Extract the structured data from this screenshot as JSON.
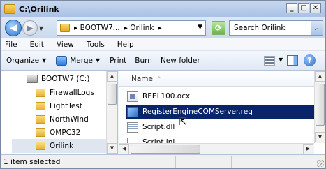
{
  "window": {
    "title": "C:\\Orilink"
  },
  "caption_buttons": {
    "minimize": "_",
    "maximize": "□",
    "close": "✕"
  },
  "address": {
    "segments": [
      "▸ BOOTW7...",
      "▸ Orilink",
      "▸"
    ],
    "search_placeholder": "Search Orilink"
  },
  "menu": {
    "items": [
      "File",
      "Edit",
      "View",
      "Tools",
      "Help"
    ]
  },
  "commands": {
    "organize": "Organize",
    "merge": "Merge",
    "print": "Print",
    "burn": "Burn",
    "new_folder": "New folder"
  },
  "nav_tree": {
    "items": [
      {
        "label": "BOOTW7 (C:)",
        "icon": "drive-icon"
      },
      {
        "label": "FirewallLogs",
        "icon": "folder-icon"
      },
      {
        "label": "LightTest",
        "icon": "folder-icon"
      },
      {
        "label": "NorthWind",
        "icon": "folder-icon"
      },
      {
        "label": "OMPC32",
        "icon": "folder-icon"
      },
      {
        "label": "Orilink",
        "icon": "folder-icon",
        "selected": true
      }
    ]
  },
  "file_list": {
    "column_name": "Name",
    "sort_glyph": "^",
    "files": [
      {
        "name": "REEL100.ocx",
        "icon": "ocx-file-icon"
      },
      {
        "name": "RegisterEngineCOMServer.reg",
        "icon": "reg-file-icon",
        "selected": true
      },
      {
        "name": "Script.dll",
        "icon": "dll-file-icon"
      },
      {
        "name": "Script.ini",
        "icon": "ini-file-icon"
      }
    ]
  },
  "status": {
    "text": "1 item selected"
  },
  "colors": {
    "selection": "#0a246a",
    "titlebar": "#a9c1e6",
    "tree_selected": "#dfe6ef"
  }
}
